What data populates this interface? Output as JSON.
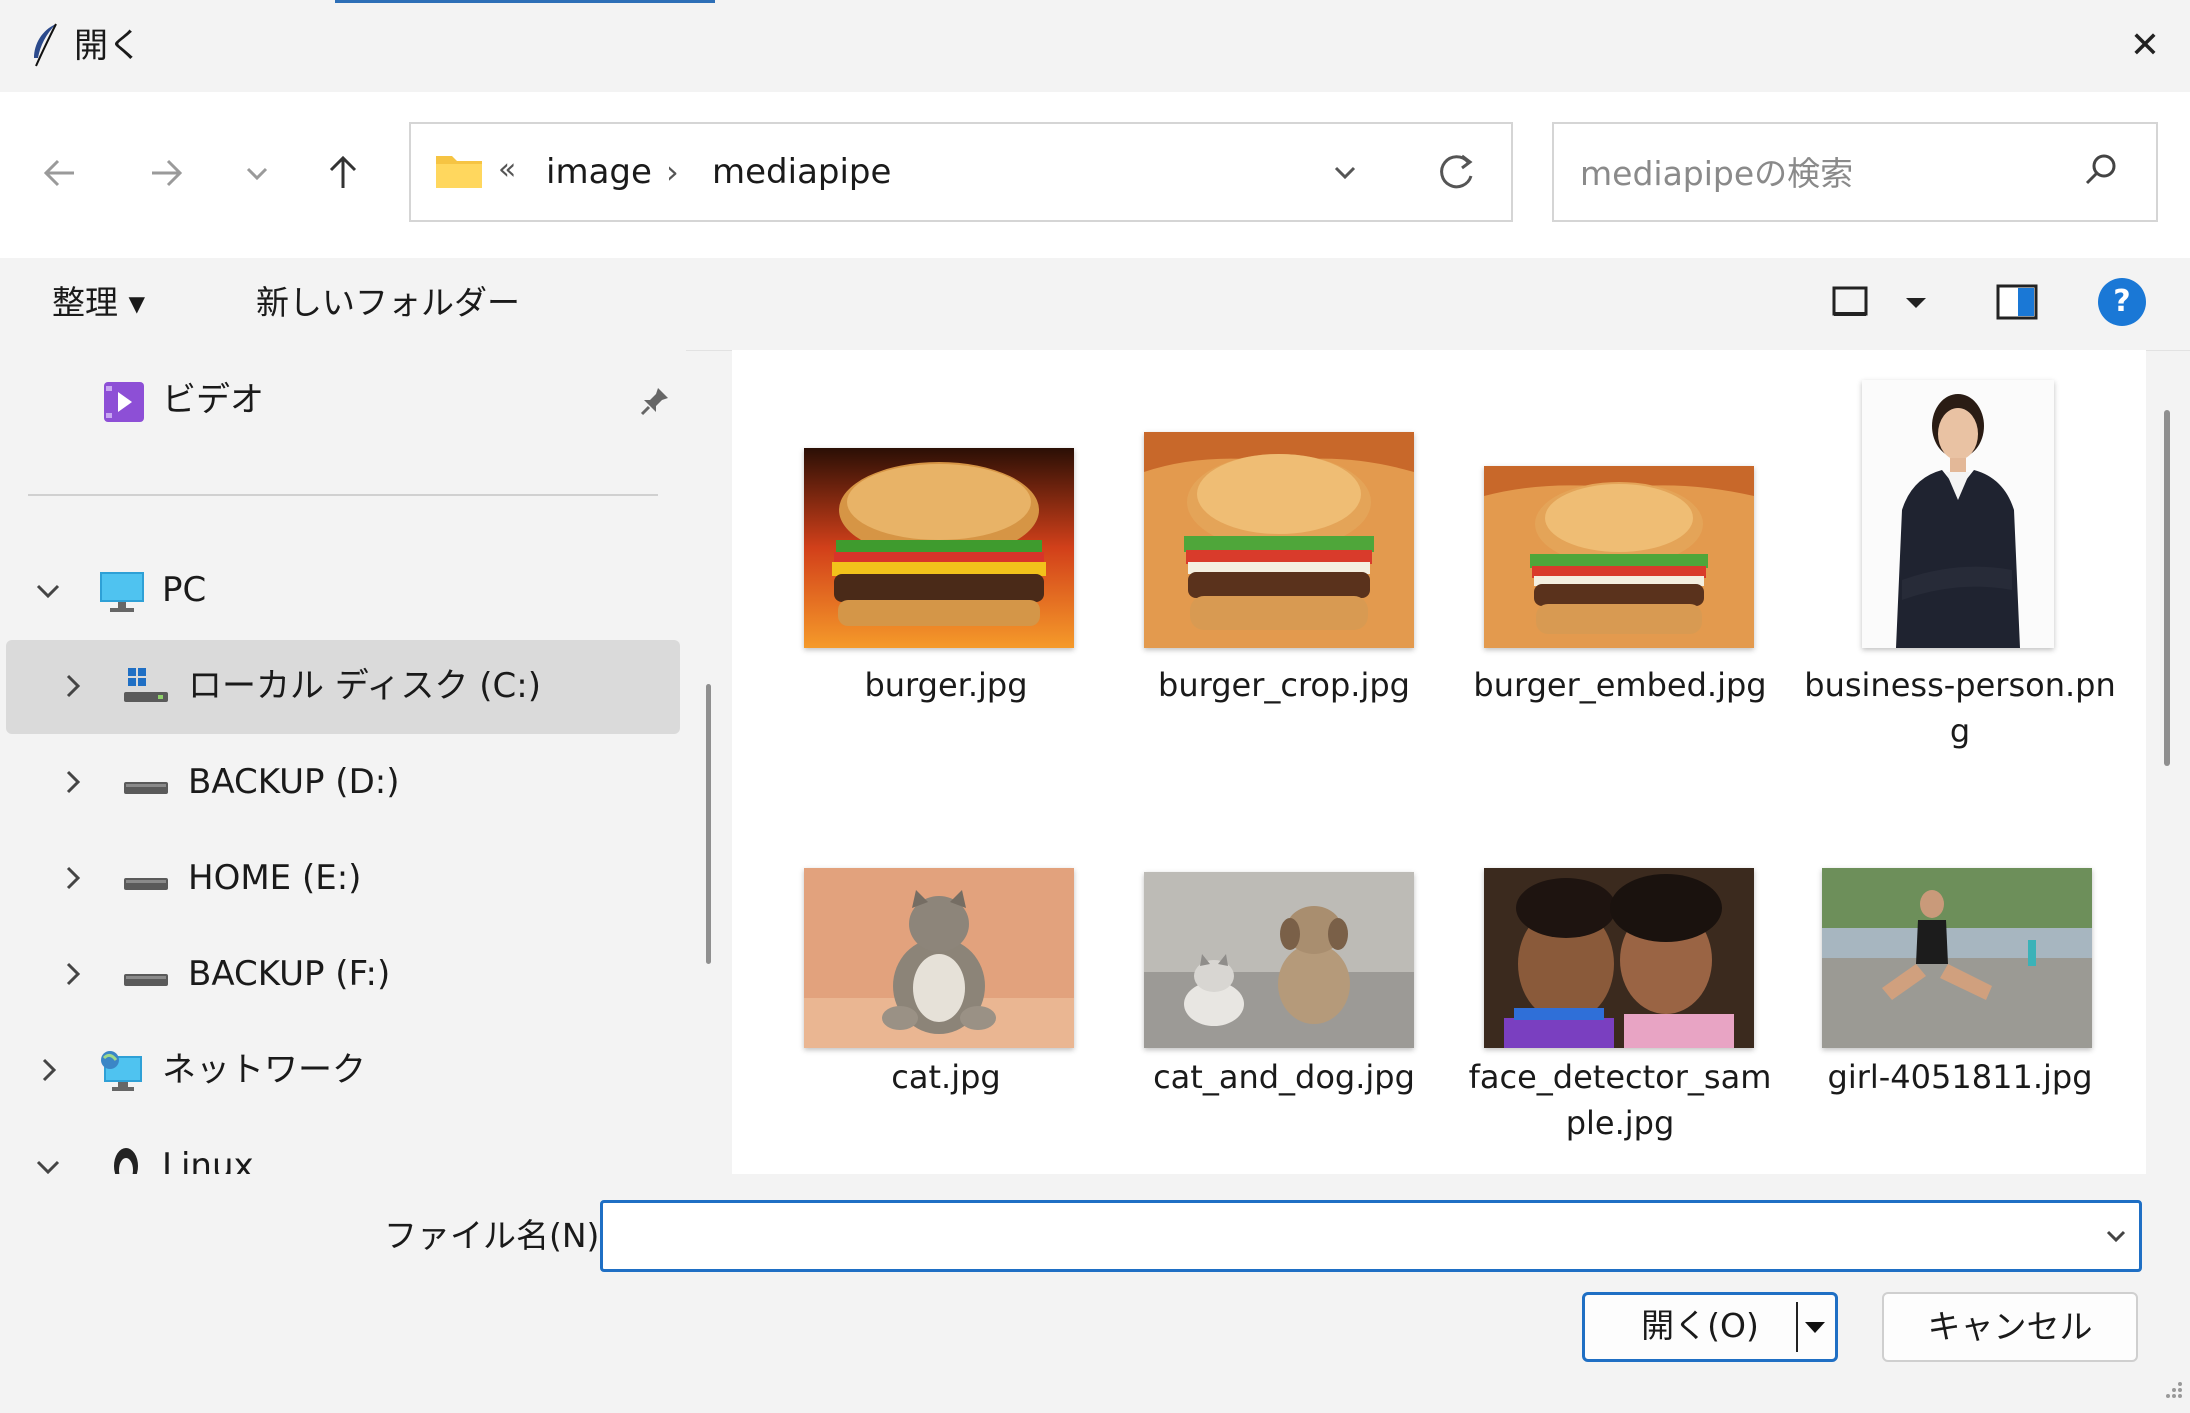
{
  "window": {
    "title": "開く",
    "close_glyph": "✕"
  },
  "address": {
    "overflow_glyph": "«",
    "crumbs": [
      "image",
      "mediapipe"
    ],
    "separator": "›"
  },
  "search": {
    "placeholder": "mediapipeの検索"
  },
  "toolbar": {
    "organize": "整理 ▾",
    "new_folder": "新しいフォルダー",
    "help": "?"
  },
  "nav": {
    "items": [
      {
        "label": "ビデオ",
        "icon": "video-folder-icon",
        "pinned": true
      },
      {
        "label": "PC",
        "icon": "pc-icon",
        "expanded": true
      },
      {
        "label": "ローカル ディスク (C:)",
        "icon": "windows-drive-icon",
        "selected": true
      },
      {
        "label": "BACKUP (D:)",
        "icon": "drive-icon"
      },
      {
        "label": "HOME (E:)",
        "icon": "drive-icon"
      },
      {
        "label": "BACKUP (F:)",
        "icon": "drive-icon"
      },
      {
        "label": "ネットワーク",
        "icon": "network-icon"
      },
      {
        "label": "Linux",
        "icon": "linux-penguin-icon",
        "expanded": true
      }
    ]
  },
  "files": [
    {
      "name": "burger.jpg"
    },
    {
      "name": "burger_crop.jpg"
    },
    {
      "name": "burger_embed.jpg"
    },
    {
      "name": "business-person.png"
    },
    {
      "name": "cat.jpg"
    },
    {
      "name": "cat_and_dog.jpg"
    },
    {
      "name": "face_detector_sample.jpg"
    },
    {
      "name": "girl-4051811.jpg"
    }
  ],
  "bottom": {
    "filename_label": "ファイル名(N):",
    "filename_value": "",
    "open_label": "開く(O)",
    "cancel_label": "キャンセル"
  },
  "colors": {
    "accent": "#1f6fc4",
    "selection": "#dadada",
    "help": "#1a78d6"
  }
}
